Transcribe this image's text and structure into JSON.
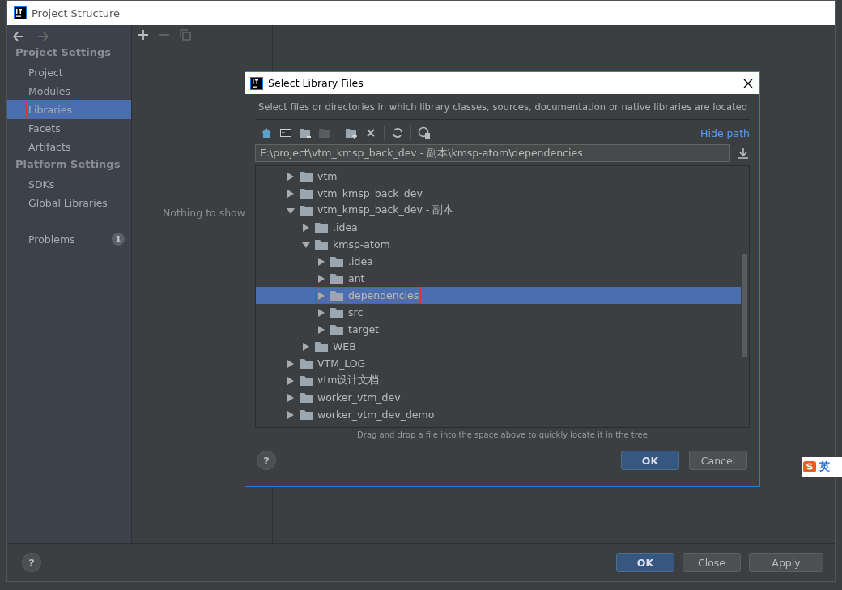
{
  "window": {
    "title": "Project Structure"
  },
  "sidebar": {
    "sections": [
      {
        "title": "Project Settings",
        "items": [
          {
            "label": "Project",
            "selected": false
          },
          {
            "label": "Modules",
            "selected": false
          },
          {
            "label": "Libraries",
            "selected": true,
            "marked": true
          },
          {
            "label": "Facets",
            "selected": false
          },
          {
            "label": "Artifacts",
            "selected": false
          }
        ]
      },
      {
        "title": "Platform Settings",
        "items": [
          {
            "label": "SDKs",
            "selected": false
          },
          {
            "label": "Global Libraries",
            "selected": false
          }
        ]
      }
    ],
    "problems": {
      "label": "Problems",
      "count": "1"
    }
  },
  "middle": {
    "empty_text": "Nothing to show"
  },
  "help": "?",
  "buttons": [
    {
      "label": "OK",
      "kind": "primary"
    },
    {
      "label": "Close",
      "kind": "secondary"
    },
    {
      "label": "Apply",
      "kind": "secondary"
    }
  ],
  "dialog": {
    "title": "Select Library Files",
    "description": "Select files or directories in which library classes, sources, documentation or native libraries are located",
    "hide_path": "Hide path",
    "path": "E:\\project\\vtm_kmsp_back_dev - 副本\\kmsp-atom\\dependencies",
    "tree": [
      {
        "label": "vtm",
        "expanded": false,
        "selected": false
      },
      {
        "label": "vtm_kmsp_back_dev",
        "expanded": false,
        "selected": false
      },
      {
        "label": "vtm_kmsp_back_dev - 副本",
        "expanded": true,
        "selected": false,
        "children": [
          {
            "label": ".idea",
            "expanded": false,
            "selected": false
          },
          {
            "label": "kmsp-atom",
            "expanded": true,
            "selected": false,
            "children": [
              {
                "label": ".idea",
                "expanded": false,
                "selected": false
              },
              {
                "label": "ant",
                "expanded": false,
                "selected": false
              },
              {
                "label": "dependencies",
                "expanded": false,
                "selected": true,
                "marked": true
              },
              {
                "label": "src",
                "expanded": false,
                "selected": false
              },
              {
                "label": "target",
                "expanded": false,
                "selected": false
              }
            ]
          },
          {
            "label": "WEB",
            "expanded": false,
            "selected": false
          }
        ]
      },
      {
        "label": "VTM_LOG",
        "expanded": false,
        "selected": false
      },
      {
        "label": "vtm设计文档",
        "expanded": false,
        "selected": false
      },
      {
        "label": "worker_vtm_dev",
        "expanded": false,
        "selected": false
      },
      {
        "label": "worker_vtm_dev_demo",
        "expanded": false,
        "selected": false
      }
    ],
    "hint": "Drag and drop a file into the space above to quickly locate it in the tree",
    "help": "?",
    "buttons": [
      {
        "label": "OK",
        "kind": "primary"
      },
      {
        "label": "Cancel",
        "kind": "secondary"
      }
    ]
  },
  "ime": {
    "label": "英"
  }
}
